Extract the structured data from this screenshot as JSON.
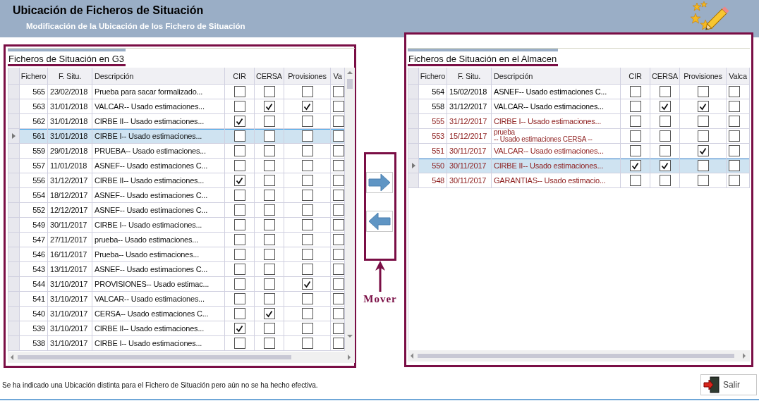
{
  "header": {
    "title": "Ubicación de Ficheros de Situación",
    "subtitle": "Modificación de la Ubicación de los Fichero de Situación"
  },
  "left_panel": {
    "title": "Ficheros de Situación en G3",
    "columns": [
      "Fichero",
      "F. Situ.",
      "Descripción",
      "CIR",
      "CERSA",
      "Provisiones",
      "Va"
    ],
    "rows": [
      {
        "fichero": "565",
        "fecha": "23/02/2018",
        "descripcion": "Prueba para sacar formalizado...",
        "checks": [
          false,
          false,
          false,
          false
        ],
        "selected": false
      },
      {
        "fichero": "563",
        "fecha": "31/01/2018",
        "descripcion": "VALCAR-- Usado estimaciones...",
        "checks": [
          false,
          true,
          true,
          false
        ],
        "selected": false
      },
      {
        "fichero": "562",
        "fecha": "31/01/2018",
        "descripcion": "CIRBE II-- Usado estimaciones...",
        "checks": [
          true,
          false,
          false,
          false
        ],
        "selected": false
      },
      {
        "fichero": "561",
        "fecha": "31/01/2018",
        "descripcion": "CIRBE I-- Usado estimaciones...",
        "checks": [
          false,
          false,
          false,
          false
        ],
        "selected": true
      },
      {
        "fichero": "559",
        "fecha": "29/01/2018",
        "descripcion": "PRUEBA-- Usado estimaciones...",
        "checks": [
          false,
          false,
          false,
          false
        ],
        "selected": false
      },
      {
        "fichero": "557",
        "fecha": "11/01/2018",
        "descripcion": "ASNEF-- Usado estimaciones C...",
        "checks": [
          false,
          false,
          false,
          false
        ],
        "selected": false
      },
      {
        "fichero": "556",
        "fecha": "31/12/2017",
        "descripcion": "CIRBE II-- Usado estimaciones...",
        "checks": [
          true,
          false,
          false,
          false
        ],
        "selected": false
      },
      {
        "fichero": "554",
        "fecha": "18/12/2017",
        "descripcion": "ASNEF-- Usado estimaciones C...",
        "checks": [
          false,
          false,
          false,
          false
        ],
        "selected": false
      },
      {
        "fichero": "552",
        "fecha": "12/12/2017",
        "descripcion": "ASNEF-- Usado estimaciones C...",
        "checks": [
          false,
          false,
          false,
          false
        ],
        "selected": false
      },
      {
        "fichero": "549",
        "fecha": "30/11/2017",
        "descripcion": "CIRBE I-- Usado estimaciones...",
        "checks": [
          false,
          false,
          false,
          false
        ],
        "selected": false
      },
      {
        "fichero": "547",
        "fecha": "27/11/2017",
        "descripcion": "prueba-- Usado estimaciones...",
        "checks": [
          false,
          false,
          false,
          false
        ],
        "selected": false
      },
      {
        "fichero": "546",
        "fecha": "16/11/2017",
        "descripcion": "Prueba-- Usado estimaciones...",
        "checks": [
          false,
          false,
          false,
          false
        ],
        "selected": false
      },
      {
        "fichero": "543",
        "fecha": "13/11/2017",
        "descripcion": "ASNEF-- Usado estimaciones C...",
        "checks": [
          false,
          false,
          false,
          false
        ],
        "selected": false
      },
      {
        "fichero": "544",
        "fecha": "31/10/2017",
        "descripcion": "PROVISIONES-- Usado estimac...",
        "checks": [
          false,
          false,
          true,
          false
        ],
        "selected": false
      },
      {
        "fichero": "541",
        "fecha": "31/10/2017",
        "descripcion": "VALCAR-- Usado estimaciones...",
        "checks": [
          false,
          false,
          false,
          false
        ],
        "selected": false
      },
      {
        "fichero": "540",
        "fecha": "31/10/2017",
        "descripcion": "CERSA-- Usado estimaciones C...",
        "checks": [
          false,
          true,
          false,
          false
        ],
        "selected": false
      },
      {
        "fichero": "539",
        "fecha": "31/10/2017",
        "descripcion": "CIRBE II-- Usado estimaciones...",
        "checks": [
          true,
          false,
          false,
          false
        ],
        "selected": false
      },
      {
        "fichero": "538",
        "fecha": "31/10/2017",
        "descripcion": "CIRBE I-- Usado estimaciones...",
        "checks": [
          false,
          false,
          false,
          false
        ],
        "selected": false
      }
    ]
  },
  "annotation": {
    "label": "Mover"
  },
  "right_panel": {
    "title": "Ficheros de Situación en el Almacen",
    "columns": [
      "Fichero",
      "F. Situ.",
      "Descripción",
      "CIR",
      "CERSA",
      "Provisiones",
      "Valca"
    ],
    "rows": [
      {
        "fichero": "564",
        "fecha": "15/02/2018",
        "descripcion": "ASNEF-- Usado estimaciones C...",
        "checks": [
          false,
          false,
          false,
          false
        ],
        "selected": false,
        "color": "#000000"
      },
      {
        "fichero": "558",
        "fecha": "31/12/2017",
        "descripcion": "VALCAR-- Usado estimaciones...",
        "checks": [
          false,
          true,
          true,
          false
        ],
        "selected": false,
        "color": "#000000"
      },
      {
        "fichero": "555",
        "fecha": "31/12/2017",
        "descripcion": "CIRBE I-- Usado estimaciones...",
        "checks": [
          false,
          false,
          false,
          false
        ],
        "selected": false,
        "color": "#8b1a1a"
      },
      {
        "fichero": "553",
        "fecha": "15/12/2017",
        "descripcion": "prueba\n-- Usado estimaciones CERSA --",
        "checks": [
          false,
          false,
          false,
          false
        ],
        "selected": false,
        "color": "#8b1a1a"
      },
      {
        "fichero": "551",
        "fecha": "30/11/2017",
        "descripcion": "VALCAR-- Usado estimaciones...",
        "checks": [
          false,
          false,
          true,
          false
        ],
        "selected": false,
        "color": "#8b1a1a"
      },
      {
        "fichero": "550",
        "fecha": "30/11/2017",
        "descripcion": "CIRBE II-- Usado estimaciones...",
        "checks": [
          true,
          true,
          false,
          false
        ],
        "selected": true,
        "color": "#8b1a1a"
      },
      {
        "fichero": "548",
        "fecha": "30/11/2017",
        "descripcion": "GARANTIAS-- Usado estimacio...",
        "checks": [
          false,
          false,
          false,
          false
        ],
        "selected": false,
        "color": "#8b1a1a"
      }
    ]
  },
  "status_message": "Se ha indicado una Ubicación distinta para el Fichero de Situación pero aún no se ha hecho efectiva.",
  "exit_button": "Salir"
}
